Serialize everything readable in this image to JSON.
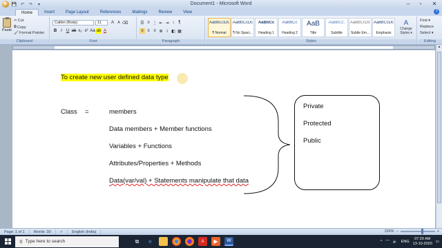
{
  "window": {
    "title": "Document1 - Microsoft Word",
    "minimize": "–",
    "maximize": "▫",
    "close": "✕"
  },
  "quick_access": {
    "save": "💾",
    "undo": "↶",
    "redo": "↷",
    "customize": "▾"
  },
  "tabs": [
    "Home",
    "Insert",
    "Page Layout",
    "References",
    "Mailings",
    "Review",
    "View"
  ],
  "help": "?",
  "ribbon": {
    "clipboard": {
      "label": "Clipboard",
      "paste": "Paste",
      "cut": "Cut",
      "copy": "Copy",
      "format_painter": "Format Painter"
    },
    "font": {
      "label": "Font",
      "font_name": "Calibri (Body)",
      "font_size": "11"
    },
    "paragraph": {
      "label": "Paragraph"
    },
    "styles": {
      "label": "Styles",
      "items": [
        {
          "sample": "AaBbCcDc",
          "name": "¶ Normal"
        },
        {
          "sample": "AaBbCcDc",
          "name": "¶ No Spaci..."
        },
        {
          "sample": "AaBbCc",
          "name": "Heading 1"
        },
        {
          "sample": "AaBbCc",
          "name": "Heading 2"
        },
        {
          "sample": "AaB",
          "name": "Title"
        },
        {
          "sample": "AaBbCc.",
          "name": "Subtitle"
        },
        {
          "sample": "AaBbCcDc",
          "name": "Subtle Em..."
        },
        {
          "sample": "AaBbCcDc",
          "name": "Emphasis"
        }
      ],
      "change_styles": "Change Styles ▾"
    },
    "editing": {
      "label": "Editing",
      "find": "Find ▾",
      "replace": "Replace",
      "select": "Select ▾"
    }
  },
  "document": {
    "heading": "To create new user defined data type",
    "class_label": "Class",
    "equals": "=",
    "lines": [
      "members",
      "Data members + Member functions",
      "Variables + Functions",
      "Attributes/Properties + Methods",
      "Data(var/val) + Statements manipulate that data"
    ],
    "access_specifiers": [
      "Private",
      "Protected",
      "Public"
    ]
  },
  "statusbar": {
    "page": "Page: 1 of 1",
    "words": "Words: 30",
    "language": "English (India)",
    "zoom": "156%",
    "zoom_fraction": 0.6
  },
  "taskbar": {
    "search_placeholder": "Type here to search",
    "language": "ENG",
    "time": "07:29 AM",
    "date": "13-10-2020"
  }
}
